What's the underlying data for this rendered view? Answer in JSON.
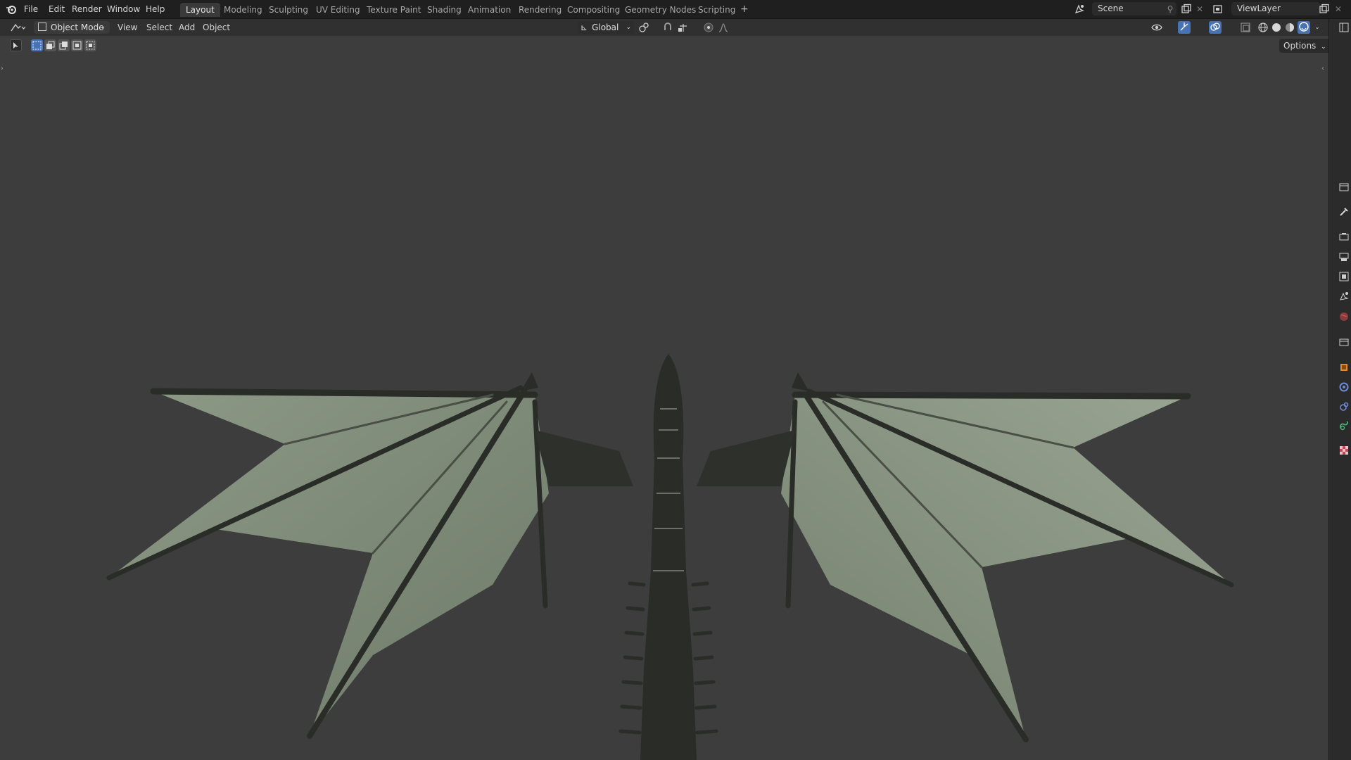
{
  "topbar": {
    "menus": [
      "File",
      "Edit",
      "Render",
      "Window",
      "Help"
    ],
    "workspaces": [
      "Layout",
      "Modeling",
      "Sculpting",
      "UV Editing",
      "Texture Paint",
      "Shading",
      "Animation",
      "Rendering",
      "Compositing",
      "Geometry Nodes",
      "Scripting"
    ],
    "active_workspace": "Layout",
    "add_workspace": "+",
    "scene_name": "Scene",
    "view_layer_name": "ViewLayer"
  },
  "header": {
    "mode": "Object Mode",
    "menus": [
      "View",
      "Select",
      "Add",
      "Object"
    ],
    "transform_orientation": "Global"
  },
  "viewport": {
    "options_label": "Options"
  },
  "colors": {
    "topbar_bg": "#1f1f1f",
    "header_bg": "#303030",
    "viewport_bg": "#3d3d3d",
    "accent_blue": "#4772b3",
    "wing_membrane": "#8a9683",
    "dragon_body": "#2a2c28"
  },
  "icons": {
    "blender_logo": "blender-logo-icon",
    "sidebar": [
      "tool-icon",
      "render-icon",
      "output-icon",
      "view-layer-icon",
      "scene-icon",
      "world-icon",
      "collection-icon",
      "object-icon",
      "modifier-icon",
      "physics-icon",
      "constraint-icon",
      "data-icon",
      "texture-icon"
    ]
  }
}
